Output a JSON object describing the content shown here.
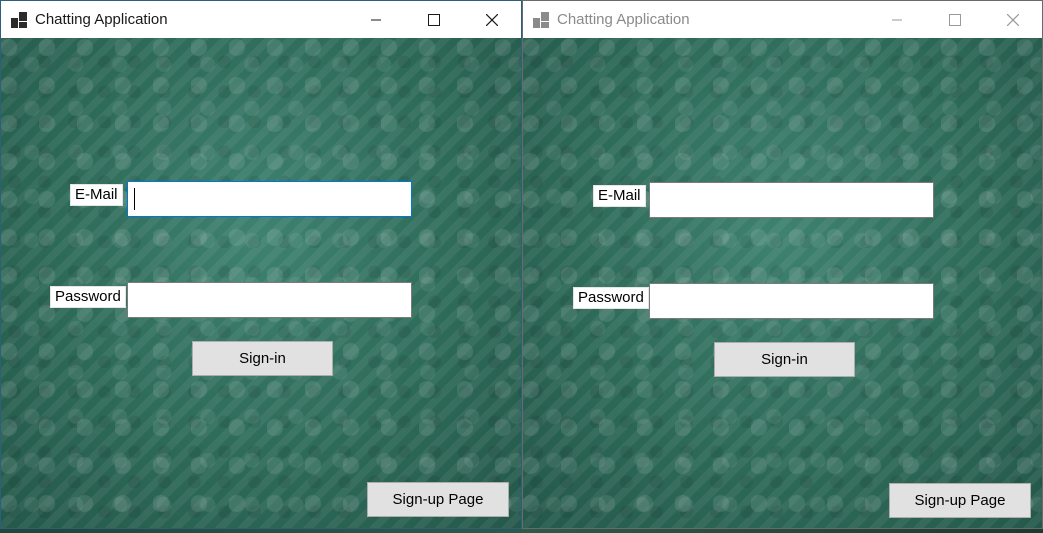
{
  "windows": [
    {
      "title": "Chatting Application",
      "active": true,
      "email_label": "E-Mail",
      "email_value": "",
      "password_label": "Password",
      "password_value": "",
      "signin_label": "Sign-in",
      "signup_label": "Sign-up Page"
    },
    {
      "title": "Chatting Application",
      "active": false,
      "email_label": "E-Mail",
      "email_value": "",
      "password_label": "Password",
      "password_value": "",
      "signin_label": "Sign-in",
      "signup_label": "Sign-up Page"
    }
  ],
  "icons": {
    "app": "app-icon",
    "minimize": "minimize-icon",
    "maximize": "maximize-icon",
    "close": "close-icon"
  },
  "colors": {
    "background_green": "#2f6d5b",
    "button_face": "#e1e1e1",
    "focus_border": "#0078d7"
  }
}
